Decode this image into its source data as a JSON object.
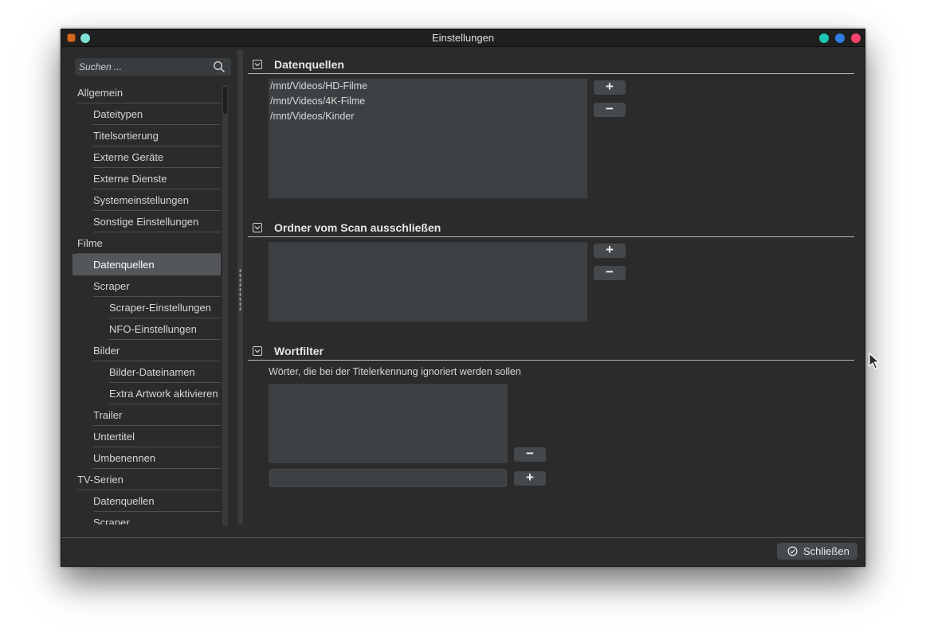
{
  "window": {
    "title": "Einstellungen",
    "controls": [
      {
        "name": "minimize",
        "color": "#1fc7b6"
      },
      {
        "name": "maximize",
        "color": "#2f7de1"
      },
      {
        "name": "close",
        "color": "#f5426c"
      }
    ],
    "left_dot_color": "#7de0d6"
  },
  "sidebar": {
    "search_placeholder": "Suchen ...",
    "items": [
      {
        "label": "Allgemein",
        "level": 0,
        "selected": false
      },
      {
        "label": "Dateitypen",
        "level": 1,
        "selected": false
      },
      {
        "label": "Titelsortierung",
        "level": 1,
        "selected": false
      },
      {
        "label": "Externe Geräte",
        "level": 1,
        "selected": false
      },
      {
        "label": "Externe Dienste",
        "level": 1,
        "selected": false
      },
      {
        "label": "Systemeinstellungen",
        "level": 1,
        "selected": false
      },
      {
        "label": "Sonstige Einstellungen",
        "level": 1,
        "selected": false
      },
      {
        "label": "Filme",
        "level": 0,
        "selected": false
      },
      {
        "label": "Datenquellen",
        "level": 1,
        "selected": true
      },
      {
        "label": "Scraper",
        "level": 1,
        "selected": false
      },
      {
        "label": "Scraper-Einstellungen",
        "level": 2,
        "selected": false
      },
      {
        "label": "NFO-Einstellungen",
        "level": 2,
        "selected": false
      },
      {
        "label": "Bilder",
        "level": 1,
        "selected": false
      },
      {
        "label": "Bilder-Dateinamen",
        "level": 2,
        "selected": false
      },
      {
        "label": "Extra Artwork aktivieren",
        "level": 2,
        "selected": false
      },
      {
        "label": "Trailer",
        "level": 1,
        "selected": false
      },
      {
        "label": "Untertitel",
        "level": 1,
        "selected": false
      },
      {
        "label": "Umbenennen",
        "level": 1,
        "selected": false
      },
      {
        "label": "TV-Serien",
        "level": 0,
        "selected": false
      },
      {
        "label": "Datenquellen",
        "level": 1,
        "selected": false
      },
      {
        "label": "Scraper",
        "level": 1,
        "selected": false
      }
    ]
  },
  "sections": {
    "datenquellen": {
      "title": "Datenquellen",
      "entries": [
        "/mnt/Videos/HD-Filme",
        "/mnt/Videos/4K-Filme",
        "/mnt/Videos/Kinder"
      ],
      "add_label": "+",
      "remove_label": "−"
    },
    "ordner": {
      "title": "Ordner vom Scan ausschließen",
      "add_label": "+",
      "remove_label": "−"
    },
    "wortfilter": {
      "title": "Wortfilter",
      "description": "Wörter, die bei der Titelerkennung ignoriert werden sollen",
      "add_label": "+",
      "remove_label": "−",
      "input_value": ""
    }
  },
  "footer": {
    "close_label": "Schließen"
  }
}
